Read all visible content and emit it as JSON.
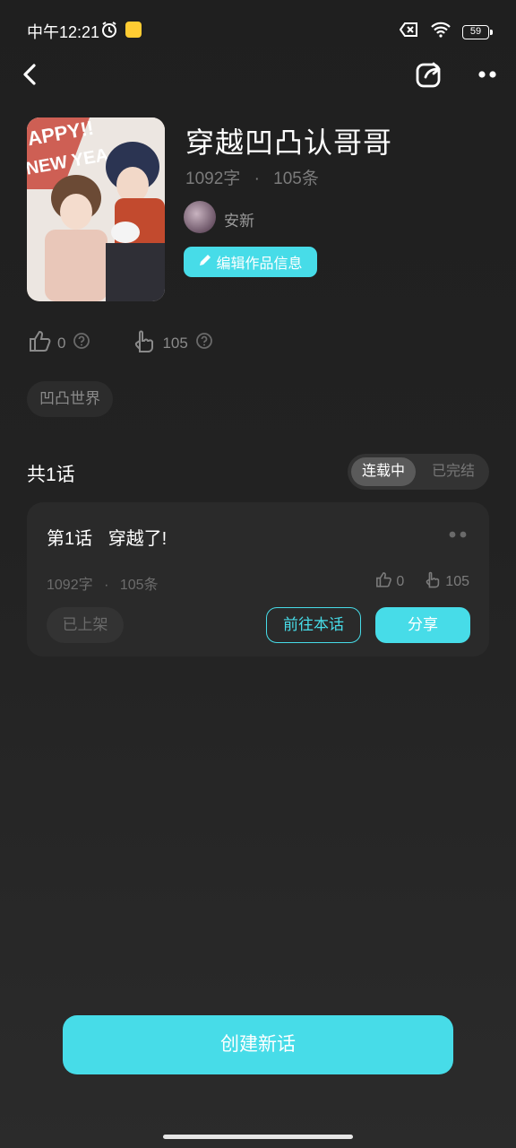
{
  "status_bar": {
    "time": "中午12:21",
    "battery": "59"
  },
  "work": {
    "title": "穿越凹凸认哥哥",
    "word_count": "1092字",
    "separator": "·",
    "entry_count": "105条",
    "author": "安新",
    "edit_label": "编辑作品信息",
    "like_count": "0",
    "recommend_count": "105",
    "tag": "凹凸世界"
  },
  "chapters": {
    "count_label": "共1话",
    "segment": {
      "active": "连载中",
      "inactive": "已完结"
    },
    "items": [
      {
        "title": "第1话",
        "subtitle": "穿越了!",
        "word_count": "1092字",
        "separator": "·",
        "entry_count": "105条",
        "likes": "0",
        "recommends": "105",
        "status_label": "已上架",
        "goto_label": "前往本话",
        "share_label": "分享"
      }
    ]
  },
  "create_button": "创建新话",
  "colors": {
    "accent": "#47dce8",
    "background": "#222222"
  }
}
